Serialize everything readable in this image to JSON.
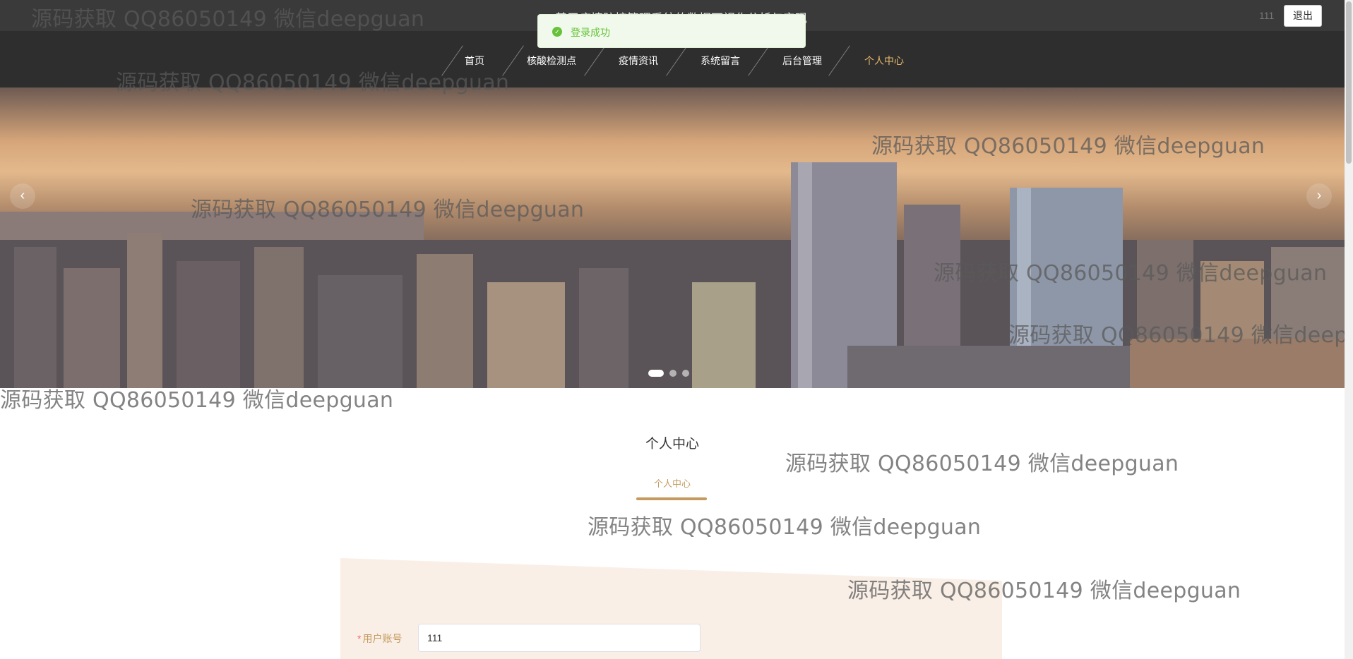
{
  "header": {
    "site_title": "基于疫情防控管理系统的数据可视化分析与实现",
    "user_name": "111",
    "logout_label": "退出"
  },
  "toast": {
    "message": "登录成功",
    "icon": "check-circle-icon",
    "color": "#67c23a"
  },
  "nav": {
    "items": [
      {
        "label": "首页"
      },
      {
        "label": "核酸检测点"
      },
      {
        "label": "疫情资讯"
      },
      {
        "label": "系统留言"
      },
      {
        "label": "后台管理"
      },
      {
        "label": "个人中心",
        "active": true
      }
    ],
    "active_color": "#e8b96a"
  },
  "carousel": {
    "slides": 3,
    "active_index": 0,
    "prev_icon": "chevron-left-icon",
    "next_icon": "chevron-right-icon",
    "prev_glyph": "‹",
    "next_glyph": "›"
  },
  "watermark": "源码获取 QQ86050149 微信deepguan",
  "section": {
    "title": "个人中心",
    "subtitle": "个人中心",
    "accent": "#c49a5e"
  },
  "form": {
    "account_label": "用户账号",
    "required_mark": "*",
    "account_value": "111"
  }
}
